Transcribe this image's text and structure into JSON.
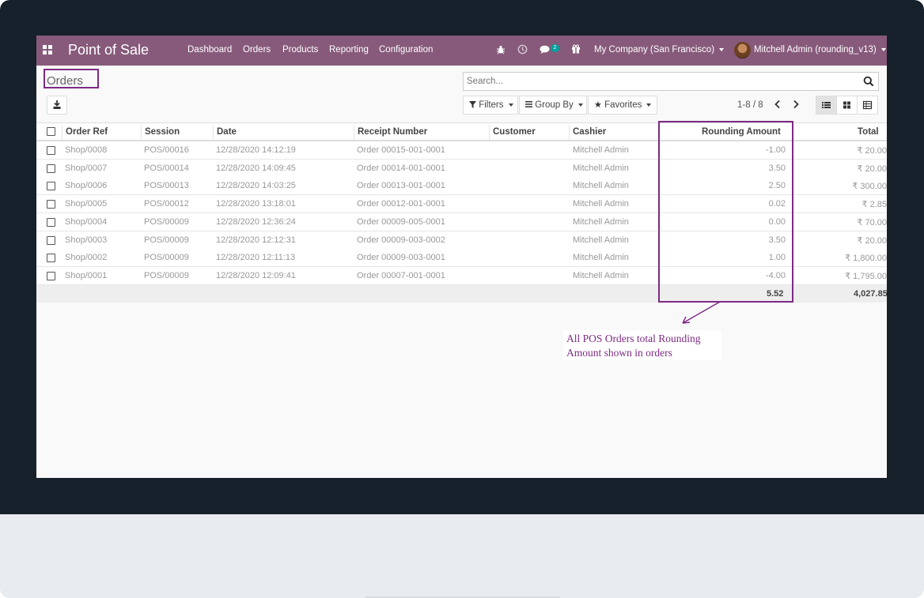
{
  "navbar": {
    "app_title": "Point of Sale",
    "menu": [
      "Dashboard",
      "Orders",
      "Products",
      "Reporting",
      "Configuration"
    ],
    "messages_badge": "2",
    "company": "My Company (San Francisco)",
    "user": "Mitchell Admin (rounding_v13)",
    "icons": [
      "apps-icon",
      "debug-icon",
      "activity-icon",
      "chat-icon",
      "gift-icon"
    ]
  },
  "control_panel": {
    "title": "Orders",
    "search_placeholder": "Search...",
    "filters_label": "Filters",
    "groupby_label": "Group By",
    "favorites_label": "Favorites",
    "pager": "1-8 / 8"
  },
  "table": {
    "columns": [
      "Order Ref",
      "Session",
      "Date",
      "Receipt Number",
      "Customer",
      "Cashier",
      "Rounding Amount",
      "Total"
    ],
    "rows": [
      {
        "ref": "Shop/0008",
        "session": "POS/00016",
        "date": "12/28/2020 14:12:19",
        "receipt": "Order 00015-001-0001",
        "customer": "",
        "cashier": "Mitchell Admin",
        "rounding": "-1.00",
        "total": "₹ 20.00"
      },
      {
        "ref": "Shop/0007",
        "session": "POS/00014",
        "date": "12/28/2020 14:09:45",
        "receipt": "Order 00014-001-0001",
        "customer": "",
        "cashier": "Mitchell Admin",
        "rounding": "3.50",
        "total": "₹ 20.00"
      },
      {
        "ref": "Shop/0006",
        "session": "POS/00013",
        "date": "12/28/2020 14:03:25",
        "receipt": "Order 00013-001-0001",
        "customer": "",
        "cashier": "Mitchell Admin",
        "rounding": "2.50",
        "total": "₹ 300.00"
      },
      {
        "ref": "Shop/0005",
        "session": "POS/00012",
        "date": "12/28/2020 13:18:01",
        "receipt": "Order 00012-001-0001",
        "customer": "",
        "cashier": "Mitchell Admin",
        "rounding": "0.02",
        "total": "₹ 2.85"
      },
      {
        "ref": "Shop/0004",
        "session": "POS/00009",
        "date": "12/28/2020 12:36:24",
        "receipt": "Order 00009-005-0001",
        "customer": "",
        "cashier": "Mitchell Admin",
        "rounding": "0.00",
        "total": "₹ 70.00"
      },
      {
        "ref": "Shop/0003",
        "session": "POS/00009",
        "date": "12/28/2020 12:12:31",
        "receipt": "Order 00009-003-0002",
        "customer": "",
        "cashier": "Mitchell Admin",
        "rounding": "3.50",
        "total": "₹ 20.00"
      },
      {
        "ref": "Shop/0002",
        "session": "POS/00009",
        "date": "12/28/2020 12:11:13",
        "receipt": "Order 00009-003-0001",
        "customer": "",
        "cashier": "Mitchell Admin",
        "rounding": "1.00",
        "total": "₹ 1,800.00"
      },
      {
        "ref": "Shop/0001",
        "session": "POS/00009",
        "date": "12/28/2020 12:09:41",
        "receipt": "Order 00007-001-0001",
        "customer": "",
        "cashier": "Mitchell Admin",
        "rounding": "-4.00",
        "total": "₹ 1,795.00"
      }
    ],
    "footer": {
      "rounding_total": "5.52",
      "grand_total": "4,027.85"
    }
  },
  "annotation": {
    "text_line1": "All POS Orders total Rounding",
    "text_line2": "Amount shown in orders",
    "color": "#7d2a83"
  },
  "colors": {
    "navbar": "#875a7b",
    "bezel": "#16212b",
    "badge": "#00a09d"
  }
}
